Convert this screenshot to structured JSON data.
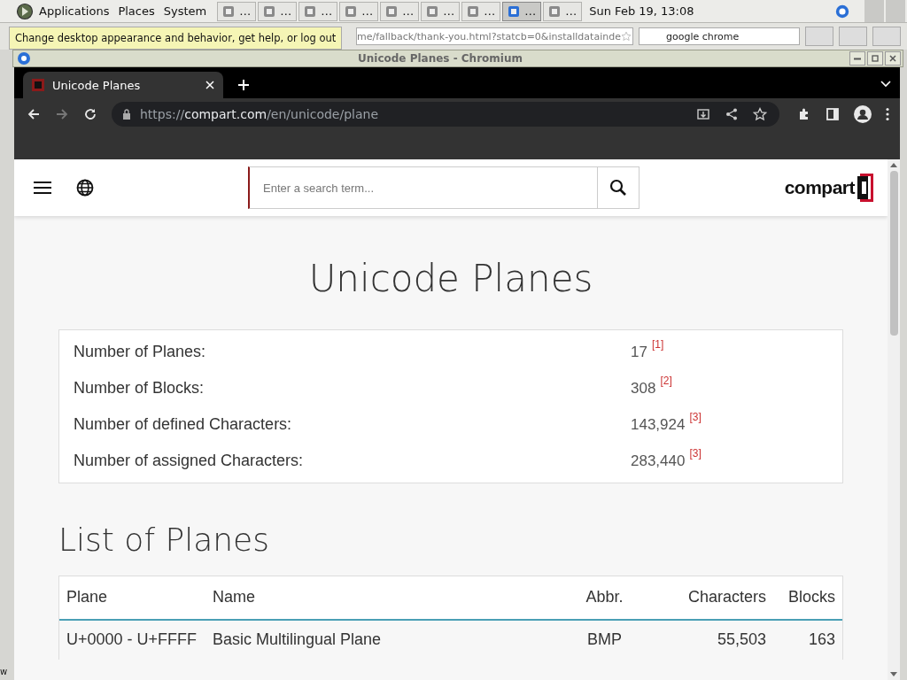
{
  "panel": {
    "menus": [
      "Applications",
      "Places",
      "System"
    ],
    "tasks": [
      {
        "label": "…",
        "selected": false
      },
      {
        "label": "…",
        "selected": false
      },
      {
        "label": "…",
        "selected": false
      },
      {
        "label": "…",
        "selected": false
      },
      {
        "label": "…",
        "selected": false
      },
      {
        "label": "…",
        "selected": false
      },
      {
        "label": "…",
        "selected": false
      },
      {
        "label": "…",
        "selected": true
      },
      {
        "label": "…",
        "selected": false
      }
    ],
    "clock": "Sun Feb 19, 13:08"
  },
  "background_window": {
    "url": "me/fallback/thank-you.html?statcb=0&installdatainde",
    "search": "google chrome"
  },
  "tooltip": "Change desktop appearance and behavior, get help, or log out",
  "desktop_fragment": "w",
  "window": {
    "title": "Unicode Planes - Chromium"
  },
  "browser": {
    "tabs": [
      {
        "title": "Unicode Planes",
        "selected": true
      }
    ],
    "url": {
      "scheme": "https://",
      "host": "compart.com",
      "path": "/en/unicode/plane"
    }
  },
  "site": {
    "search_placeholder": "Enter a search term...",
    "logo": "compart"
  },
  "page": {
    "title": "Unicode Planes",
    "stats": [
      {
        "label": "Number of Planes:",
        "value": "17",
        "ref": "[1]"
      },
      {
        "label": "Number of Blocks:",
        "value": "308",
        "ref": "[2]"
      },
      {
        "label": "Number of defined Characters:",
        "value": "143,924",
        "ref": "[3]"
      },
      {
        "label": "Number of assigned Characters:",
        "value": "283,440",
        "ref": "[3]"
      }
    ],
    "list_title": "List of Planes",
    "table": {
      "columns": [
        "Plane",
        "Name",
        "Abbr.",
        "Characters",
        "Blocks"
      ],
      "rows": [
        [
          "U+0000 - U+FFFF",
          "Basic Multilingual Plane",
          "BMP",
          "55,503",
          "163"
        ]
      ]
    }
  }
}
